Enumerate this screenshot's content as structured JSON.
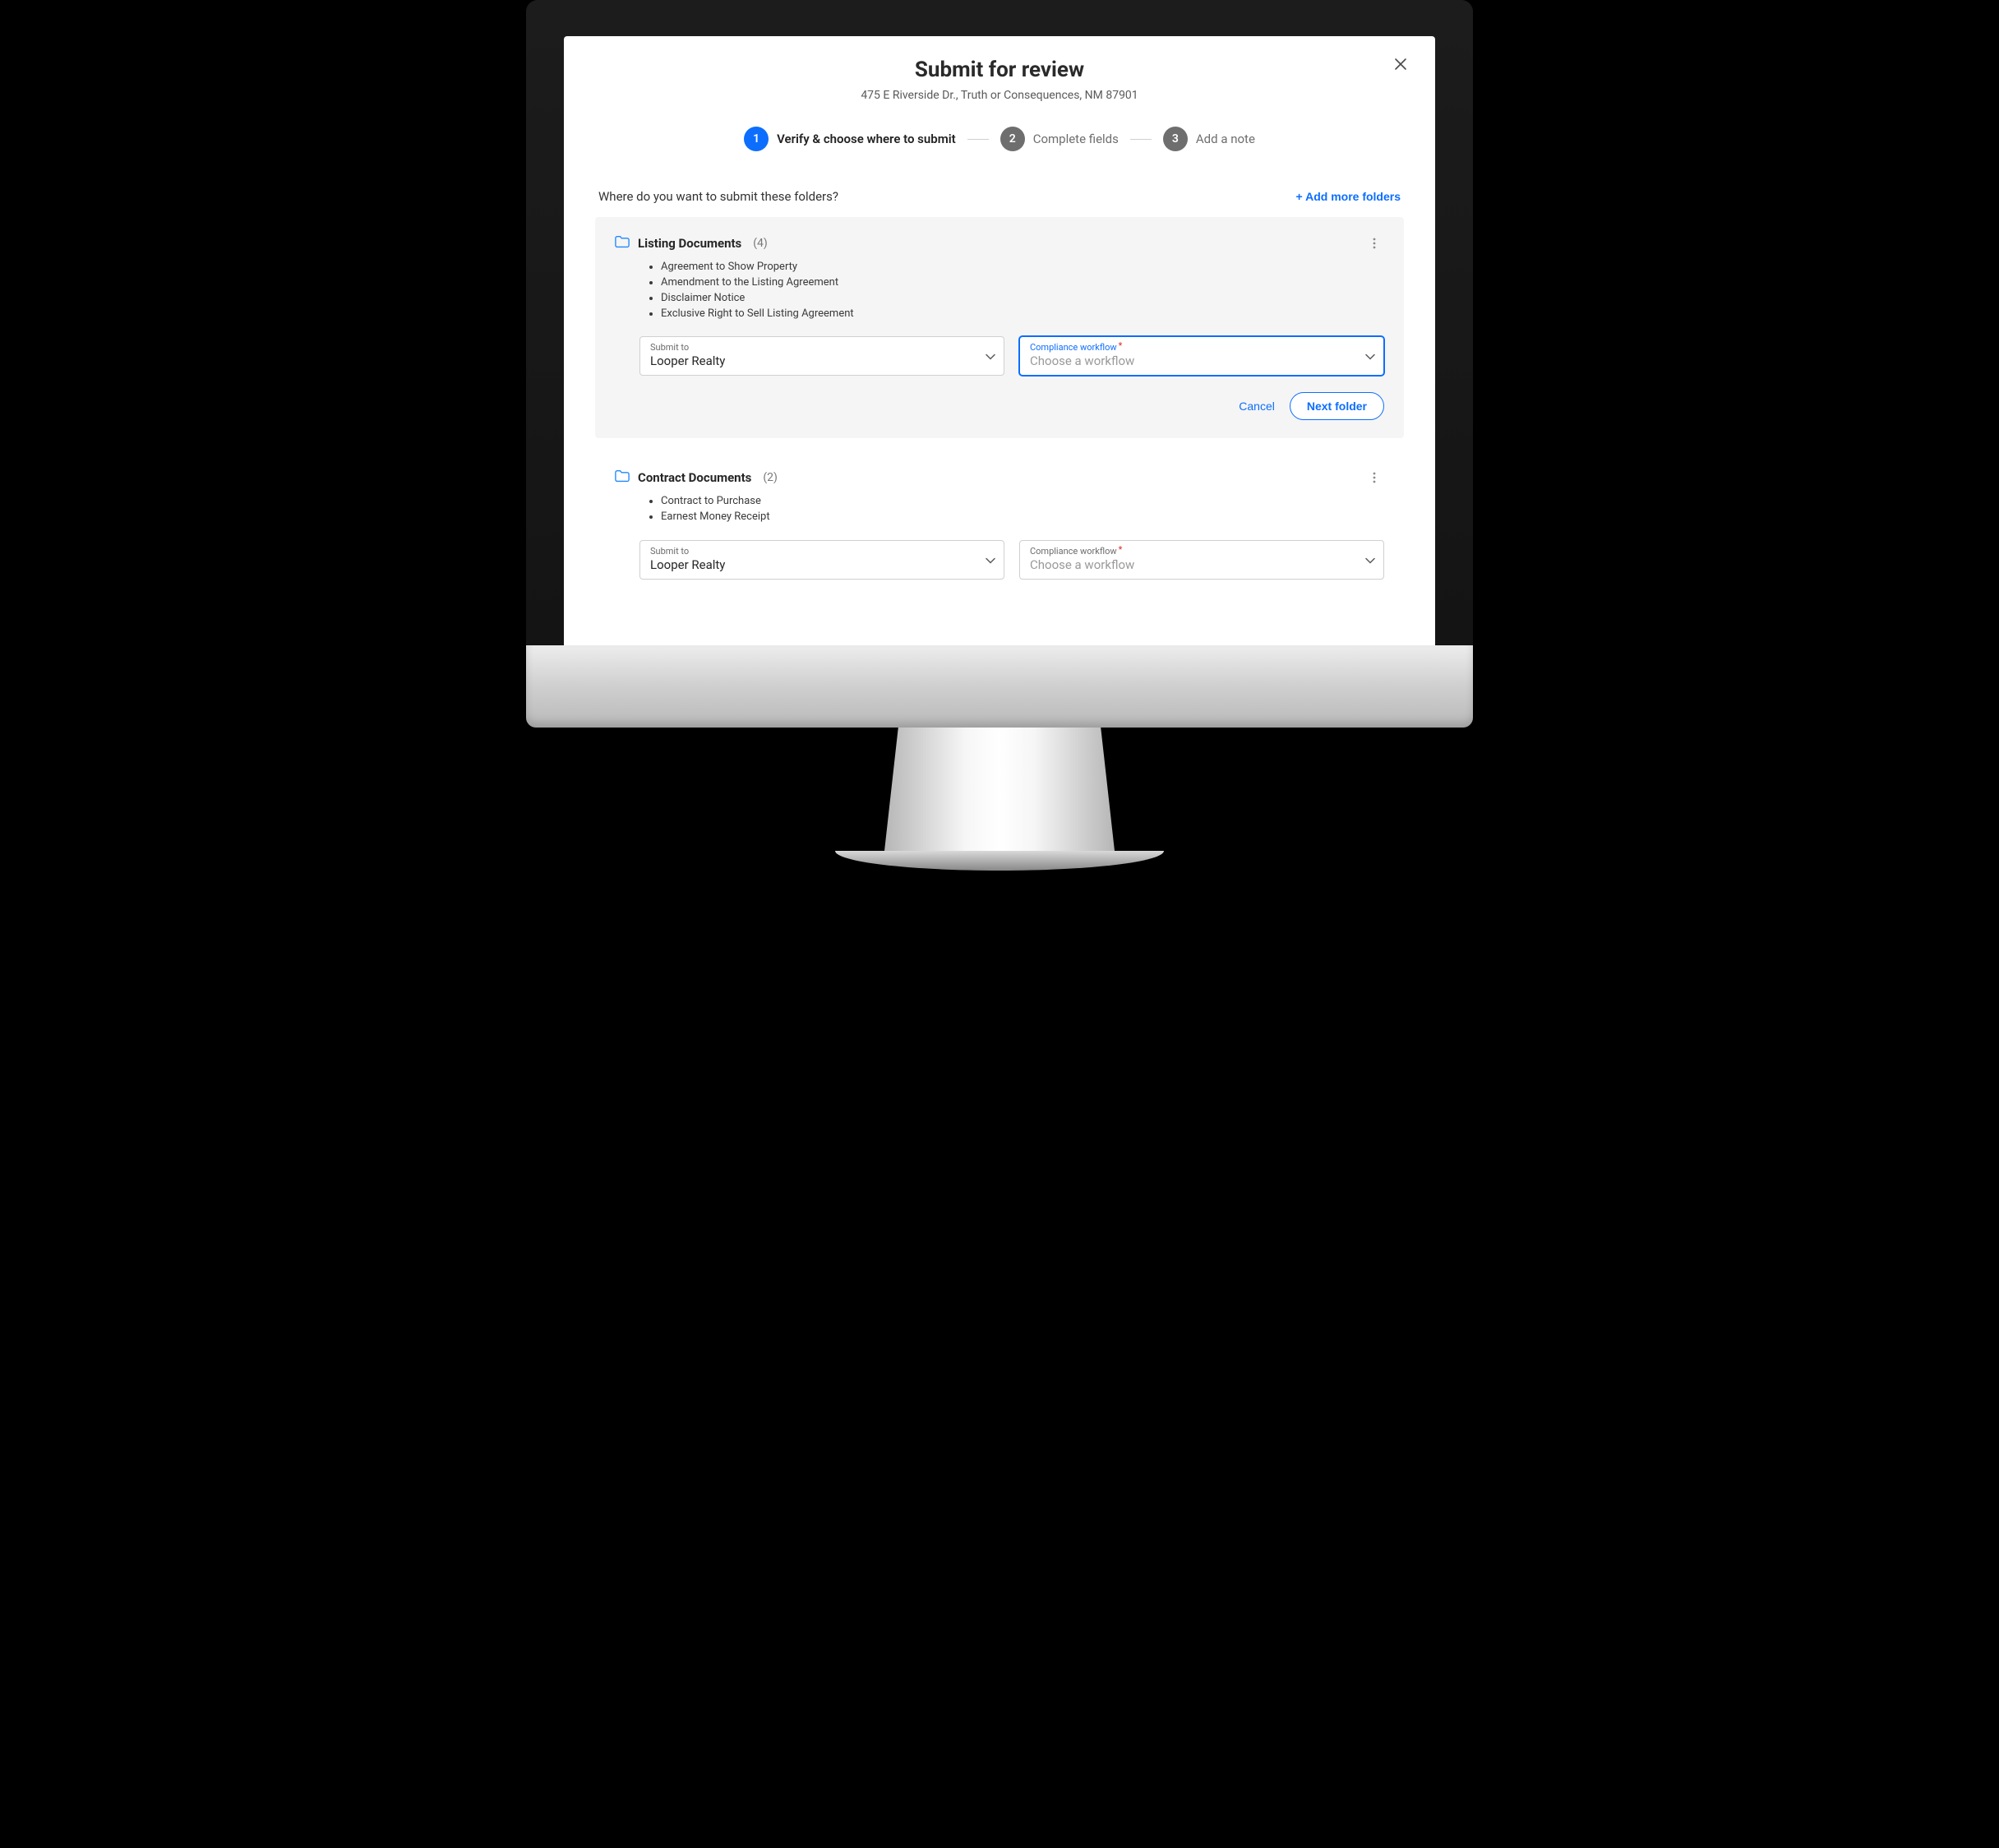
{
  "modal": {
    "title": "Submit for review",
    "subtitle": "475 E Riverside Dr., Truth or Consequences, NM 87901"
  },
  "stepper": {
    "steps": [
      {
        "num": "1",
        "label": "Verify & choose where to submit",
        "active": true
      },
      {
        "num": "2",
        "label": "Complete fields",
        "active": false
      },
      {
        "num": "3",
        "label": "Add a note",
        "active": false
      }
    ]
  },
  "section": {
    "question": "Where do you want to submit these folders?",
    "add_more": "+ Add more folders"
  },
  "folders": [
    {
      "title": "Listing Documents",
      "count": "(4)",
      "items": [
        "Agreement to Show Property",
        "Amendment to the Listing Agreement",
        "Disclaimer Notice",
        "Exclusive Right to Sell Listing Agreement"
      ],
      "submit_to_label": "Submit to",
      "submit_to_value": "Looper Realty",
      "compliance_label": "Compliance workflow",
      "compliance_placeholder": "Choose a workflow",
      "compliance_focused": true,
      "show_actions": true
    },
    {
      "title": "Contract Documents",
      "count": "(2)",
      "items": [
        "Contract to Purchase",
        "Earnest Money Receipt"
      ],
      "submit_to_label": "Submit to",
      "submit_to_value": "Looper Realty",
      "compliance_label": "Compliance workflow",
      "compliance_placeholder": "Choose a workflow",
      "compliance_focused": false,
      "show_actions": false
    }
  ],
  "actions": {
    "cancel": "Cancel",
    "next_folder": "Next folder"
  }
}
